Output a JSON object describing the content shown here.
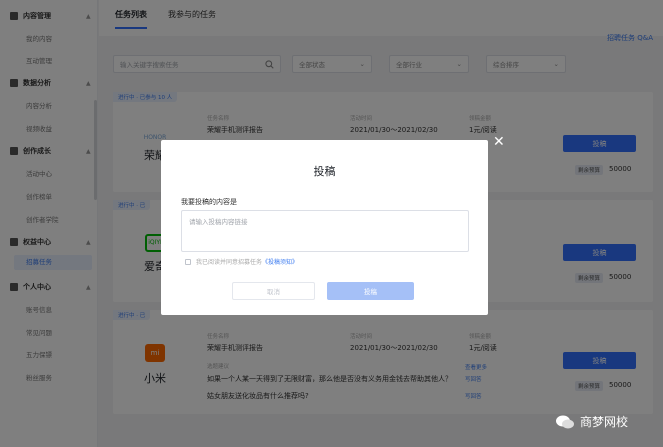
{
  "sidebar": {
    "groups": [
      {
        "label": "内容管理",
        "items": [
          "我的内容",
          "互动管理"
        ]
      },
      {
        "label": "数据分析",
        "items": [
          "内容分析",
          "视频收益"
        ]
      },
      {
        "label": "创作成长",
        "items": [
          "活动中心",
          "创作榜单",
          "创作者学院"
        ]
      },
      {
        "label": "权益中心",
        "items": [
          "招募任务"
        ]
      },
      {
        "label": "个人中心",
        "items": [
          "账号信息",
          "常见问题",
          "五力保镖",
          "粉丝服务"
        ]
      }
    ],
    "active_item": "招募任务"
  },
  "tabs": [
    "任务列表",
    "我参与的任务"
  ],
  "qa_link": "招聘任务 Q&A",
  "filters": {
    "search_placeholder": "输入关键字搜索任务",
    "status": "全部状态",
    "industry": "全部行业",
    "sort": "综合排序"
  },
  "cards": [
    {
      "status": "进行中 · 已参与 10 人",
      "brand": "荣耀",
      "brand_mark": "HONOR",
      "labels": {
        "name": "任务名称",
        "period": "活动时间",
        "price": "领稿金额",
        "budget": "剩余预算"
      },
      "name": "荣耀手机测评报告",
      "period": "2021/01/30～2021/02/30",
      "price": "1元/阅读",
      "budget": "50000",
      "action": "投稿"
    },
    {
      "status": "进行中 · 已",
      "brand": "爱奇",
      "brand_mark": "iQIYI",
      "labels": {
        "budget": "剩余预算"
      },
      "budget": "50000",
      "action": "投稿"
    },
    {
      "status": "进行中 · 已",
      "brand": "小米",
      "brand_mark": "mi",
      "labels": {
        "name": "任务名称",
        "period": "活动时间",
        "price": "领稿金额",
        "topic": "选题建议",
        "budget": "剩余预算"
      },
      "name": "荣耀手机测评报告",
      "period": "2021/01/30～2021/02/30",
      "price": "1元/阅读",
      "question1": "如果一个人某一天得到了无限财富，那么他是否没有义务用金钱去帮助其他人？",
      "question2": "姑女朋友送化妆品有什么推荐吗?",
      "link_more": "查看更多",
      "link_write1": "写回答",
      "link_write2": "写回答",
      "budget": "50000",
      "action": "投稿"
    }
  ],
  "modal": {
    "title": "投稿",
    "label": "我要投稿的内容是",
    "placeholder": "请输入投稿内容链接",
    "agree_prefix": "我已阅读并同意招募任务",
    "agree_link": "《投稿须知》",
    "cancel": "取消",
    "submit": "投稿"
  },
  "watermark": "商梦网校",
  "colors": {
    "primary": "#3370ff",
    "xiaomi": "#ff6900",
    "iqiyi": "#00be06"
  }
}
